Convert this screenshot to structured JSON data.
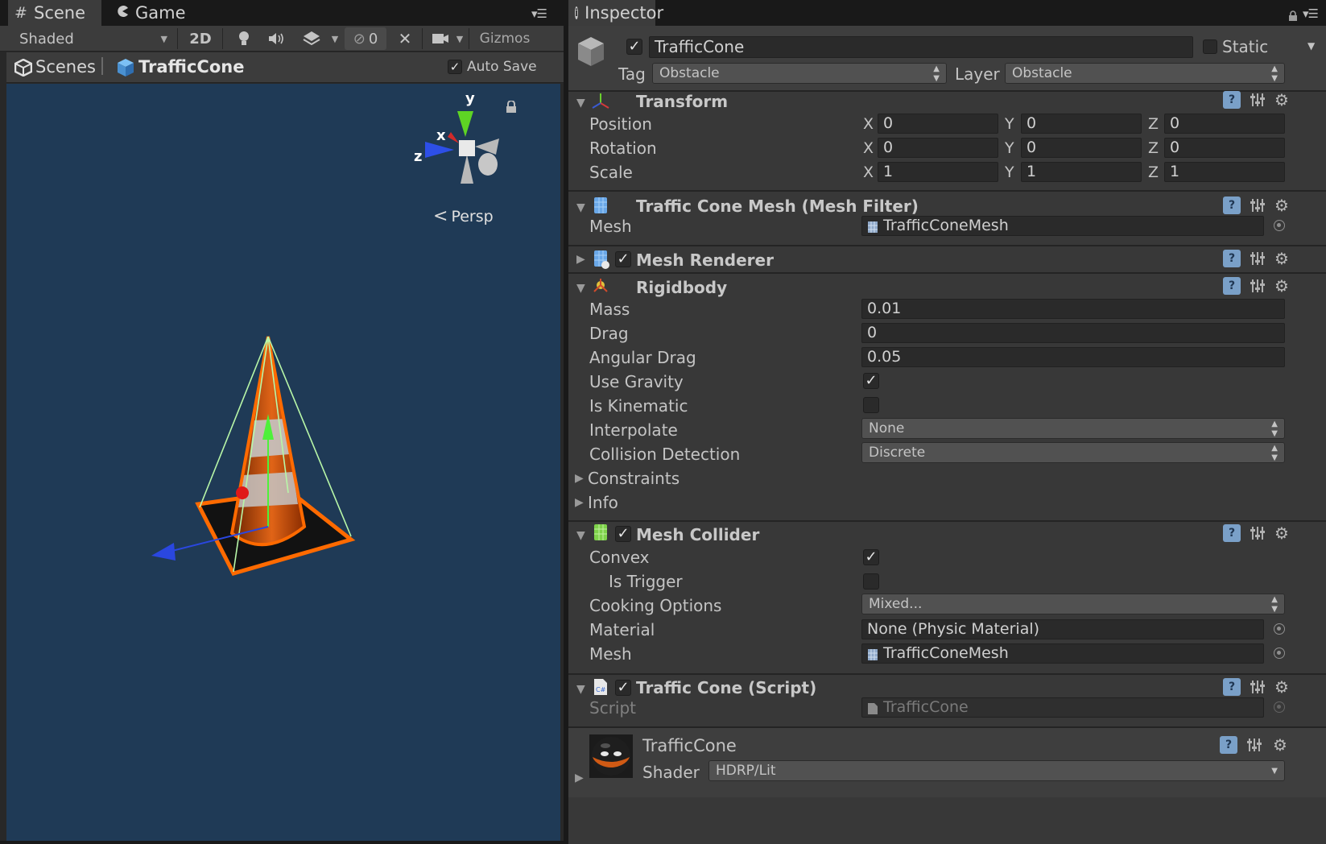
{
  "scene_panel": {
    "tabs": [
      {
        "label": "Scene",
        "icon": "grid-icon"
      },
      {
        "label": "Game",
        "icon": "pacman-icon"
      }
    ],
    "toolbar": {
      "shading_mode": "Shaded",
      "mode_2d": "2D",
      "hidden_count": "0",
      "gizmos_label": "Gizmos"
    },
    "breadcrumb": {
      "root": "Scenes",
      "current": "TrafficCone",
      "auto_save_label": "Auto Save",
      "auto_save_checked": true
    },
    "viewport": {
      "axis_y": "y",
      "axis_x": "x",
      "axis_z": "z",
      "projection_label": "Persp",
      "background_color": "#1f3a56"
    }
  },
  "inspector": {
    "tab_label": "Inspector",
    "object": {
      "active": true,
      "name": "TrafficCone",
      "static_label": "Static",
      "static_checked": false,
      "tag_label": "Tag",
      "tag_value": "Obstacle",
      "layer_label": "Layer",
      "layer_value": "Obstacle"
    },
    "transform": {
      "title": "Transform",
      "rows": [
        {
          "label": "Position",
          "x": "0",
          "y": "0",
          "z": "0"
        },
        {
          "label": "Rotation",
          "x": "0",
          "y": "0",
          "z": "0"
        },
        {
          "label": "Scale",
          "x": "1",
          "y": "1",
          "z": "1"
        }
      ],
      "axis_labels": [
        "X",
        "Y",
        "Z"
      ]
    },
    "mesh_filter": {
      "title": "Traffic Cone Mesh (Mesh Filter)",
      "mesh_label": "Mesh",
      "mesh_value": "TrafficConeMesh"
    },
    "mesh_renderer": {
      "title": "Mesh Renderer",
      "enabled": true
    },
    "rigidbody": {
      "title": "Rigidbody",
      "mass_label": "Mass",
      "mass": "0.01",
      "drag_label": "Drag",
      "drag": "0",
      "angular_drag_label": "Angular Drag",
      "angular_drag": "0.05",
      "use_gravity_label": "Use Gravity",
      "use_gravity": true,
      "is_kinematic_label": "Is Kinematic",
      "is_kinematic": false,
      "interpolate_label": "Interpolate",
      "interpolate": "None",
      "collision_label": "Collision Detection",
      "collision": "Discrete",
      "constraints_label": "Constraints",
      "info_label": "Info"
    },
    "mesh_collider": {
      "title": "Mesh Collider",
      "enabled": true,
      "convex_label": "Convex",
      "convex": true,
      "is_trigger_label": "Is Trigger",
      "is_trigger": false,
      "cooking_label": "Cooking Options",
      "cooking": "Mixed...",
      "material_label": "Material",
      "material": "None (Physic Material)",
      "mesh_label": "Mesh",
      "mesh": "TrafficConeMesh"
    },
    "script": {
      "title": "Traffic Cone (Script)",
      "enabled": true,
      "script_label": "Script",
      "script_value": "TrafficCone"
    },
    "material": {
      "name": "TrafficCone",
      "shader_label": "Shader",
      "shader": "HDRP/Lit"
    }
  },
  "colors": {
    "accent_selection": "#ff6a00",
    "help_icon": "#7aa0c8"
  }
}
